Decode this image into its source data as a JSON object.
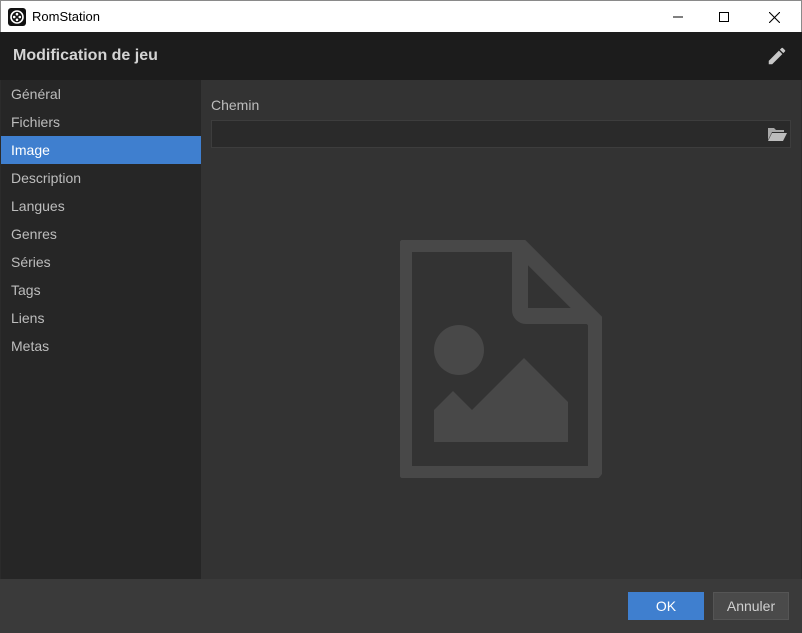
{
  "window": {
    "title": "RomStation",
    "app_icon": "romstation-logo-icon",
    "controls": {
      "minimize": "minimize-icon",
      "maximize": "maximize-icon",
      "close": "close-icon"
    }
  },
  "header": {
    "title": "Modification de jeu",
    "action_icon": "pencil-icon"
  },
  "sidebar": {
    "items": [
      {
        "label": "Général",
        "active": false
      },
      {
        "label": "Fichiers",
        "active": false
      },
      {
        "label": "Image",
        "active": true
      },
      {
        "label": "Description",
        "active": false
      },
      {
        "label": "Langues",
        "active": false
      },
      {
        "label": "Genres",
        "active": false
      },
      {
        "label": "Séries",
        "active": false
      },
      {
        "label": "Tags",
        "active": false
      },
      {
        "label": "Liens",
        "active": false
      },
      {
        "label": "Metas",
        "active": false
      }
    ]
  },
  "content": {
    "path_label": "Chemin",
    "path_value": "",
    "browse_icon": "folder-open-icon",
    "preview_icon": "image-file-icon"
  },
  "footer": {
    "ok_label": "OK",
    "cancel_label": "Annuler"
  },
  "colors": {
    "accent": "#3f7fcf",
    "header_bg": "#1c1c1c",
    "sidebar_bg": "#262626",
    "content_bg": "#333333"
  }
}
